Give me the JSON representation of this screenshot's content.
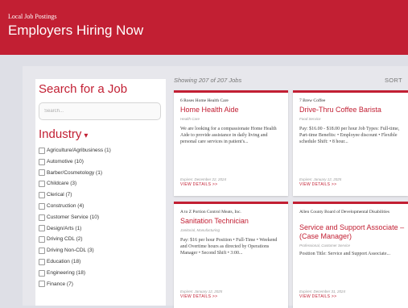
{
  "header": {
    "subtitle": "Local Job Postings",
    "title": "Employers Hiring Now"
  },
  "sidebar": {
    "search_title": "Search for a Job",
    "search_placeholder": "Search...",
    "industry_title": "Industry",
    "industry_caret": "▾",
    "industries": [
      "Agriculture/Agribusiness (1)",
      "Automotive (10)",
      "Barber/Cosmetology (1)",
      "Childcare (3)",
      "Clerical (7)",
      "Construction (4)",
      "Customer Service (10)",
      "Design/Arts (1)",
      "Driving CDL (2)",
      "Driving Non-CDL (3)",
      "Education (18)",
      "Engineering (18)",
      "Finance (7)"
    ]
  },
  "results": {
    "showing": "Showing 207 of 207 Jobs",
    "sort": "SORT"
  },
  "jobs": [
    {
      "employer": "6 Roses Home Health Care",
      "title": "Home Health Aide",
      "category": "Health Care",
      "description": "We are looking for a compassionate Home Health Aide to provide assistance in daily living and personal care services in patient's...",
      "expires": "Expires: December 22, 2024",
      "details": "VIEW DETAILS >>"
    },
    {
      "employer": "7 Brew Coffee",
      "title": "Drive-Thru Coffee Barista",
      "category": "Food Service",
      "description": "Pay: $16.00 - $18.00 per hour Job Types: Full-time, Part-time Benefits: • Employee discount • Flexible schedule Shift: • 8 hour...",
      "expires": "Expires: January 12, 2025",
      "details": "VIEW DETAILS >>"
    },
    {
      "employer": "A to Z Portion Control Meats, Inc.",
      "title": "Sanitation Technician",
      "category": "Janitorial, Manufacturing",
      "description": "Pay: $16 per hour Position • Full-Time • Weekend and Overtime hours as directed by Operations Manager • Second Shift • 3:00...",
      "expires": "Expires: January 12, 2025",
      "details": "VIEW DETAILS >>"
    },
    {
      "employer": "Allen County Board of Developmental Disabilities",
      "title": "Service and Support Associate – (Case Manager)",
      "category": "Professional, Customer Service",
      "description": "Position Title: Service and Support Associate...",
      "expires": "Expires: December 31, 2024",
      "details": "VIEW DETAILS >>"
    }
  ]
}
